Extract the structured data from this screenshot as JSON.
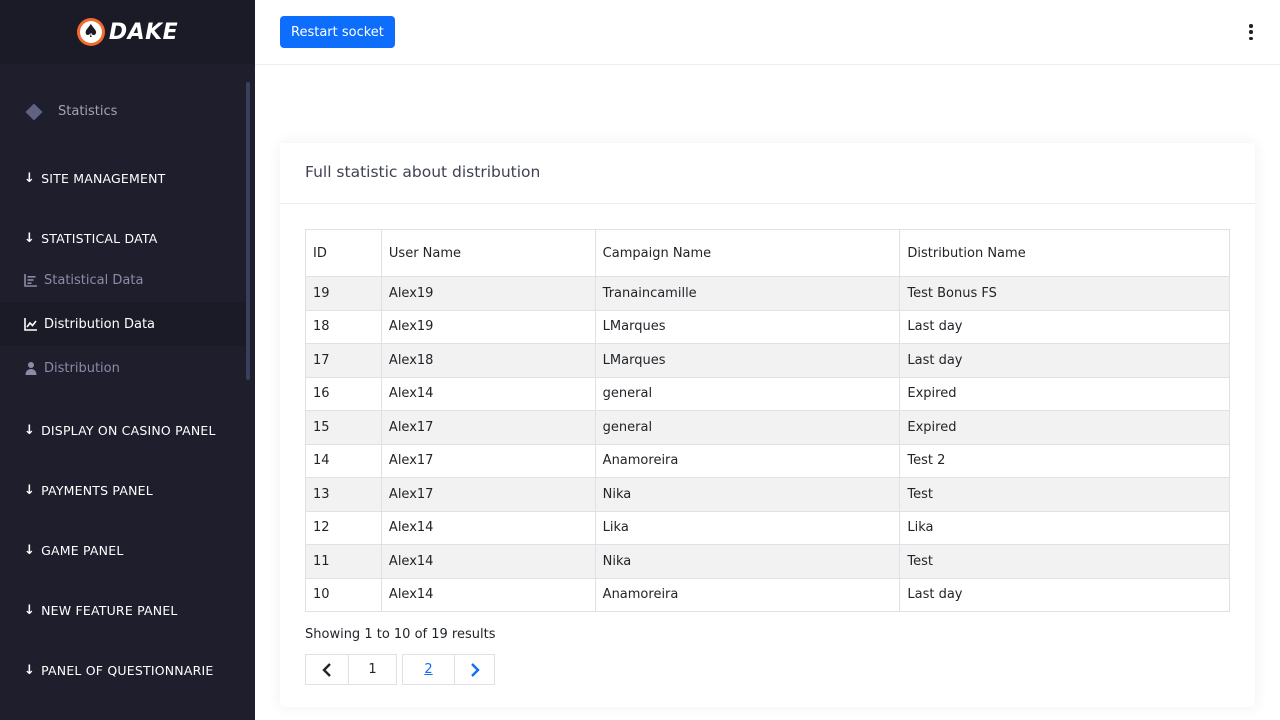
{
  "brand": {
    "name": "DAKE",
    "logo_icon": "spade-icon",
    "logo_color": "#f26a2e"
  },
  "sidebar": {
    "top_item": {
      "label": "Statistics",
      "icon": "diamond-icon"
    },
    "sections": [
      {
        "label": "SITE MANAGEMENT"
      },
      {
        "label": "STATISTICAL DATA"
      },
      {
        "label": "DISPLAY ON CASINO PANEL"
      },
      {
        "label": "PAYMENTS PANEL"
      },
      {
        "label": "GAME PANEL"
      },
      {
        "label": "NEW FEATURE PANEL"
      },
      {
        "label": "PANEL OF QUESTIONNARIE"
      }
    ],
    "sub_items": [
      {
        "label": "Statistical Data",
        "icon": "bar-chart-icon",
        "active": false
      },
      {
        "label": "Distribution Data",
        "icon": "line-chart-icon",
        "active": true
      },
      {
        "label": "Distribution",
        "icon": "user-icon",
        "active": false
      }
    ]
  },
  "topbar": {
    "restart_label": "Restart socket",
    "accent": "#0d6efd"
  },
  "card": {
    "title": "Full statistic about distribution",
    "columns": [
      "ID",
      "User Name",
      "Campaign Name",
      "Distribution Name"
    ],
    "rows": [
      [
        "19",
        "Alex19",
        "Tranaincamille",
        "Test Bonus FS"
      ],
      [
        "18",
        "Alex19",
        "LMarques",
        "Last day"
      ],
      [
        "17",
        "Alex18",
        "LMarques",
        "Last day"
      ],
      [
        "16",
        "Alex14",
        "general",
        "Expired"
      ],
      [
        "15",
        "Alex17",
        "general",
        "Expired"
      ],
      [
        "14",
        "Alex17",
        "Anamoreira",
        "Test 2"
      ],
      [
        "13",
        "Alex17",
        "Nika",
        "Test"
      ],
      [
        "12",
        "Alex14",
        "Lika",
        "Lika"
      ],
      [
        "11",
        "Alex14",
        "Nika",
        "Test"
      ],
      [
        "10",
        "Alex14",
        "Anamoreira",
        "Last day"
      ]
    ],
    "showing_text": "Showing 1 to 10 of 19 results",
    "pagination": {
      "pages": [
        "1",
        "2"
      ],
      "current": "1"
    }
  }
}
